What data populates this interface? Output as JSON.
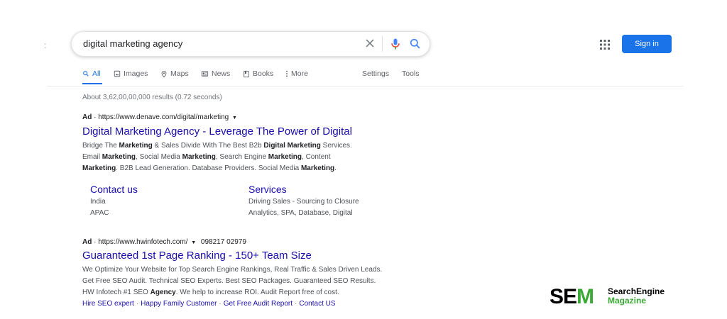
{
  "left_mark": ":",
  "search": {
    "query": "digital marketing agency"
  },
  "header": {
    "sign_in_label": "Sign in"
  },
  "tabs": [
    {
      "label": "All",
      "icon": "search-icon"
    },
    {
      "label": "Images",
      "icon": "image-icon"
    },
    {
      "label": "Maps",
      "icon": "map-pin-icon"
    },
    {
      "label": "News",
      "icon": "newspaper-icon"
    },
    {
      "label": "Books",
      "icon": "book-icon"
    },
    {
      "label": "More",
      "icon": "more-vert-icon"
    },
    {
      "label": "Settings"
    },
    {
      "label": "Tools"
    }
  ],
  "stats": "About 3,62,00,00,000 results (0.72 seconds)",
  "ads": [
    {
      "ad_label": "Ad",
      "dot": "·",
      "url": "https://www.denave.com/digital/marketing",
      "title": "Digital Marketing Agency - Leverage The Power of Digital",
      "description_lines": [
        [
          "Bridge The ",
          "Marketing",
          " & Sales Divide With The Best B2b ",
          "Digital Marketing",
          " Services."
        ],
        [
          "Email ",
          "Marketing",
          ", Social Media ",
          "Marketing",
          ", Search Engine ",
          "Marketing",
          ", Content"
        ],
        [
          "",
          "Marketing",
          ". B2B Lead Generation. Database Providers. Social Media ",
          "Marketing",
          "."
        ]
      ],
      "sitelinks": [
        {
          "title": "Contact us",
          "lines": [
            "India",
            "APAC"
          ]
        },
        {
          "title": "Services",
          "lines": [
            "Driving Sales - Sourcing to Closure",
            "Analytics, SPA, Database, Digital"
          ]
        }
      ]
    },
    {
      "ad_label": "Ad",
      "dot": "·",
      "url": "https://www.hwinfotech.com/",
      "phone": "098217 02979",
      "title": "Guaranteed 1st Page Ranking - 150+ Team Size",
      "description_lines": [
        [
          "We Optimize Your Website for Top Search Engine Rankings, Real Traffic & Sales Driven Leads."
        ],
        [
          "Get Free SEO Audit. Technical SEO Experts. Best SEO Packages. Guaranteed SEO Results."
        ],
        [
          "HW Infotech #1 SEO ",
          "Agency",
          ". We help to increase ROI. Audit Report free of cost."
        ]
      ],
      "inline_sitelinks": [
        "Hire SEO expert",
        "Happy Family Customer",
        "Get Free Audit Report",
        "Contact US"
      ],
      "sitelink_separator": "·"
    }
  ],
  "logo": {
    "letters_1": "SE",
    "letters_2": "M",
    "line_1": "SearchEngine",
    "line_2": "Magazine"
  },
  "colors": {
    "link": "#1a0dab",
    "accent": "#1a73e8",
    "logo_green": "#3aa935"
  }
}
